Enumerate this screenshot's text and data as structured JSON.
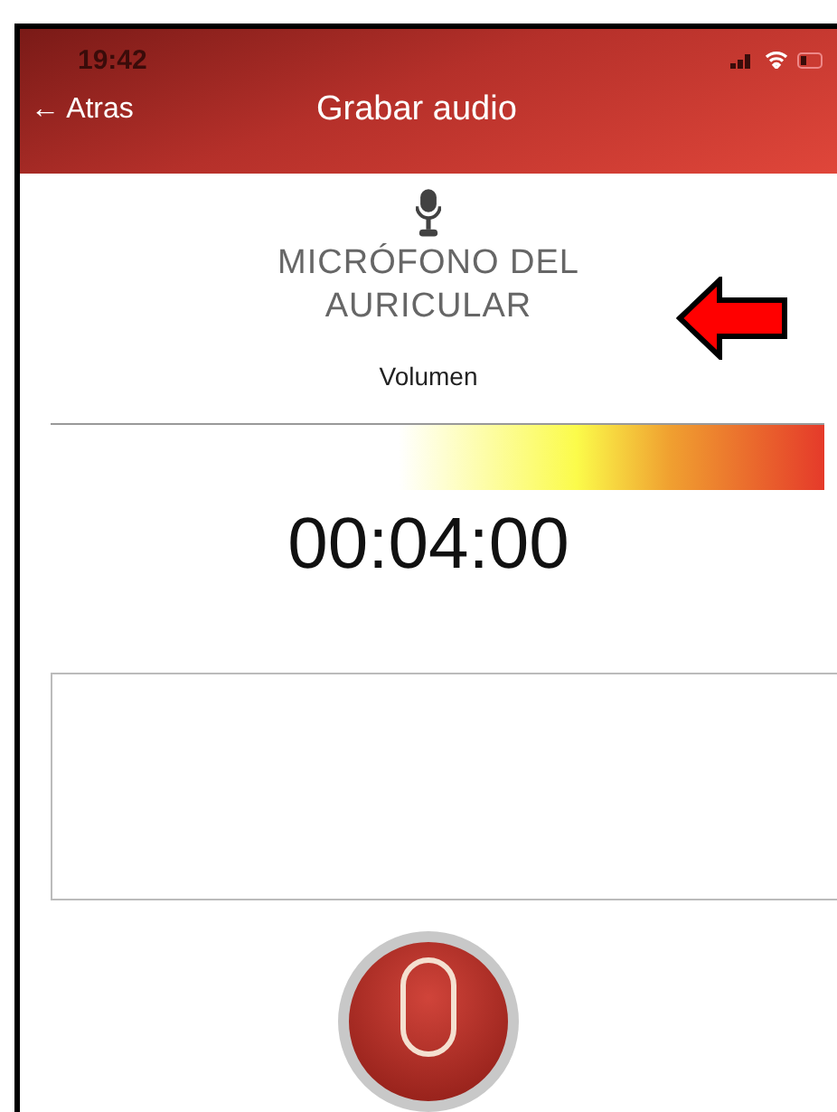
{
  "status_bar": {
    "time": "19:42"
  },
  "nav_bar": {
    "back": "← Atras",
    "title": "Grabar audio"
  },
  "source": {
    "label": "MICRÓFONO DEL AURICULAR"
  },
  "volume": {
    "label": "Volumen",
    "level": 1
  },
  "timer": "00:04:00"
}
